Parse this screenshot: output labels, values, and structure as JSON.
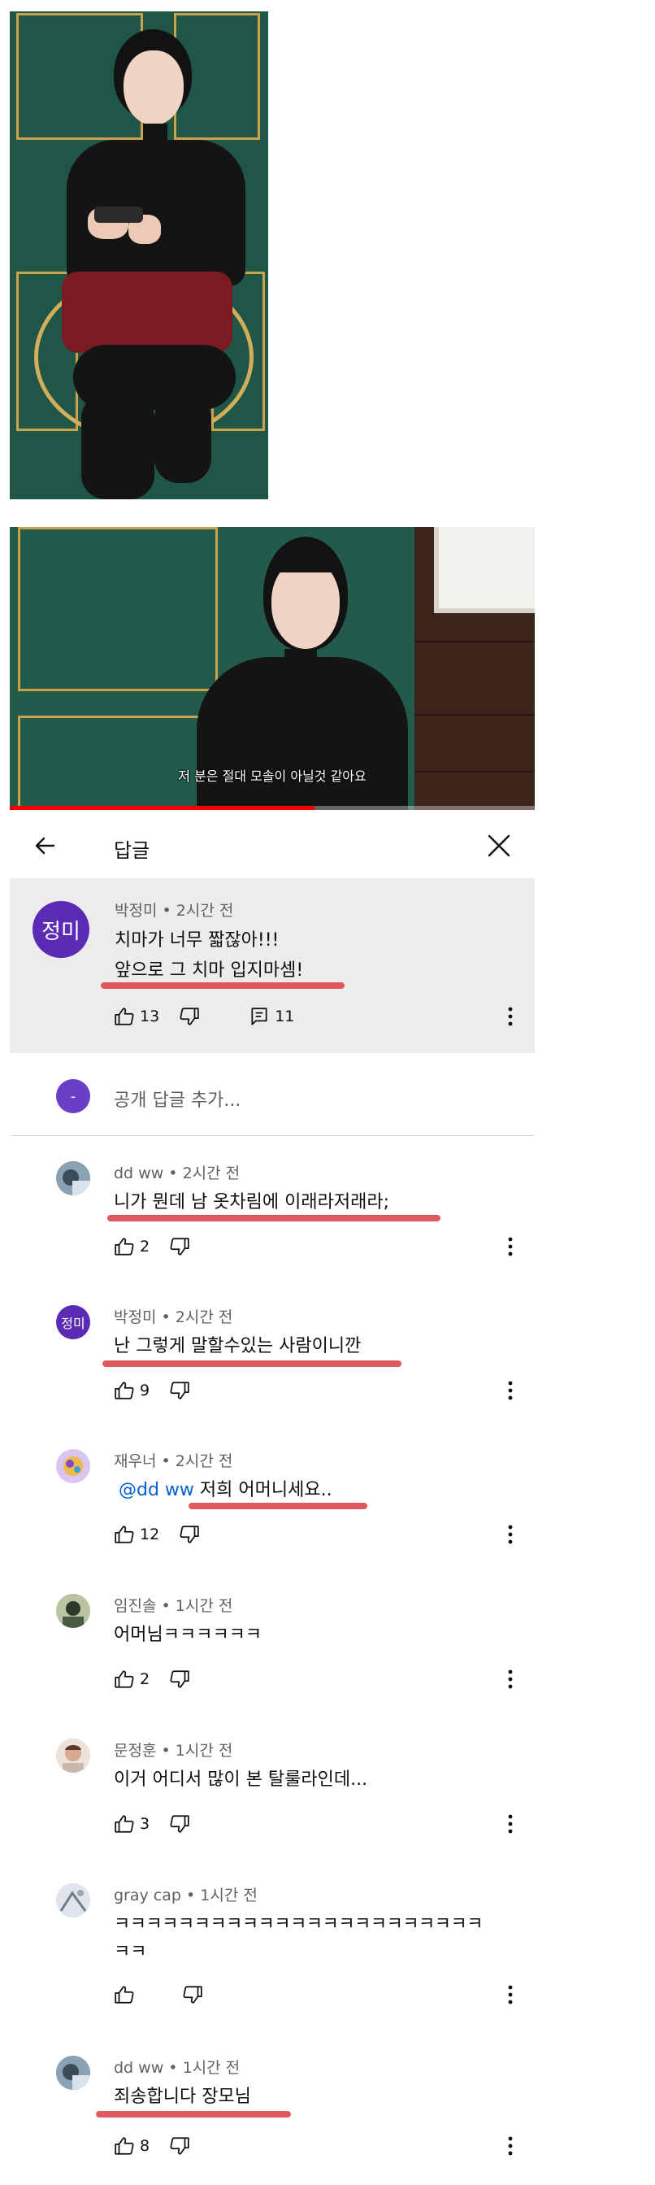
{
  "video": {
    "subtitle": "저 분은 절대 모솔이 아닐것 같아요"
  },
  "header": {
    "back_icon": "arrow-left-icon",
    "title": "답글",
    "close_icon": "close-icon"
  },
  "parent_comment": {
    "avatar_text": "정미",
    "avatar_color": "#5b2bb5",
    "author": "박정미",
    "time": "2시간 전",
    "line1": "치마가 너무 짧잖아!!!",
    "line2": "앞으로 그 치마 입지마셈!",
    "likes": "13",
    "replies": "11"
  },
  "add_reply": {
    "avatar_text": "-",
    "placeholder": "공개 답글 추가..."
  },
  "separator": "•",
  "replies": [
    {
      "author": "dd ww",
      "time": "2시간 전",
      "text": "니가 뭔데 남 옷차림에 이래라저래라;",
      "likes": "2"
    },
    {
      "author": "박정미",
      "time": "2시간 전",
      "avatar_text": "정미",
      "text": "난 그렇게 말할수있는 사람이니깐",
      "likes": "9"
    },
    {
      "author": "재우너",
      "time": "2시간 전",
      "mention": "@dd ww",
      "text": "저희 어머니세요..",
      "likes": "12"
    },
    {
      "author": "임진솔",
      "time": "1시간 전",
      "text": "어머님ㅋㅋㅋㅋㅋㅋ",
      "likes": "2"
    },
    {
      "author": "문정훈",
      "time": "1시간 전",
      "text": "이거 어디서 많이 본 탈룰라인데...",
      "likes": "3"
    },
    {
      "author": "gray cap",
      "time": "1시간 전",
      "text_line1": "ㅋㅋㅋㅋㅋㅋㅋㅋㅋㅋㅋㅋㅋㅋㅋㅋㅋㅋㅋㅋㅋㅋㅋ",
      "text_line2": "ㅋㅋ",
      "likes": ""
    },
    {
      "author": "dd ww",
      "time": "1시간 전",
      "text": "죄송합니다 장모님",
      "likes": "8"
    }
  ],
  "colors": {
    "underline": "#dc4b50",
    "parent_bg": "#ececec",
    "mention": "#065fd4"
  }
}
